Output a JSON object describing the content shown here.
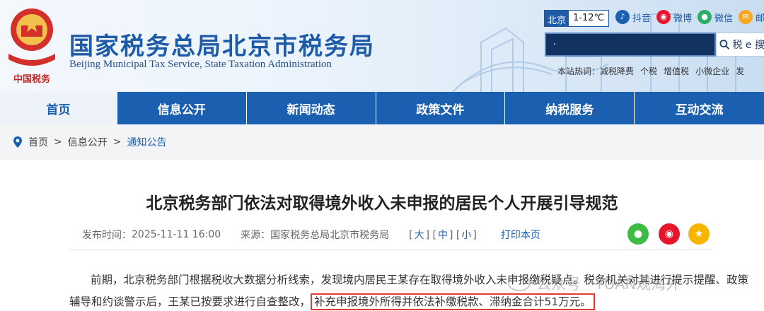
{
  "header": {
    "emblem_text": "中国税务",
    "title": "国家税务总局北京市税务局",
    "subtitle": "Beijing Municipal Tax Service, State Taxation Administration",
    "weather_city": "北京",
    "weather_temp": "1-12℃",
    "social": [
      {
        "label": "抖音",
        "icon": "douyin-icon",
        "color": "#1b5fb0"
      },
      {
        "label": "微博",
        "icon": "weibo-icon",
        "color": "#e6162d"
      },
      {
        "label": "微信",
        "icon": "wechat-icon",
        "color": "#2aae67"
      },
      {
        "label": "邮",
        "icon": "mail-icon",
        "color": "#f5a623"
      }
    ],
    "search_value": "·",
    "search_button": "税 e 搜",
    "hot_label": "本站热词：",
    "hot_words": [
      "减税降费",
      "个税",
      "增值税",
      "小微企业",
      "发"
    ]
  },
  "nav": [
    "首页",
    "信息公开",
    "新闻动态",
    "政策文件",
    "纳税服务",
    "互动交流"
  ],
  "breadcrumb": {
    "home": "首页",
    "level1": "信息公开",
    "current": "通知公告",
    "sep": ">"
  },
  "article": {
    "title": "北京税务部门依法对取得境外收入未申报的居民个人开展引导规范",
    "publish_label": "发布时间：",
    "publish_time": "2025-11-11 16:00",
    "source_label": "来源：",
    "source": "国家税务总局北京市税务局",
    "size_large": "大",
    "size_medium": "中",
    "size_small": "小",
    "print": "打印本页",
    "para1": "前期，北京税务部门根据税收大数据分析线索，发现境内居民王某存在取得境外收入未申报缴税疑点。税务机关对其进行提示提醒、政策",
    "para2_prefix": "辅导和约谈警示后，王某已按要求进行自查整改，",
    "para2_highlight": "补充申报境外所得并依法补缴税款、滞纳金合计51万元。"
  },
  "watermark": "公众号 · YUAN观海外"
}
